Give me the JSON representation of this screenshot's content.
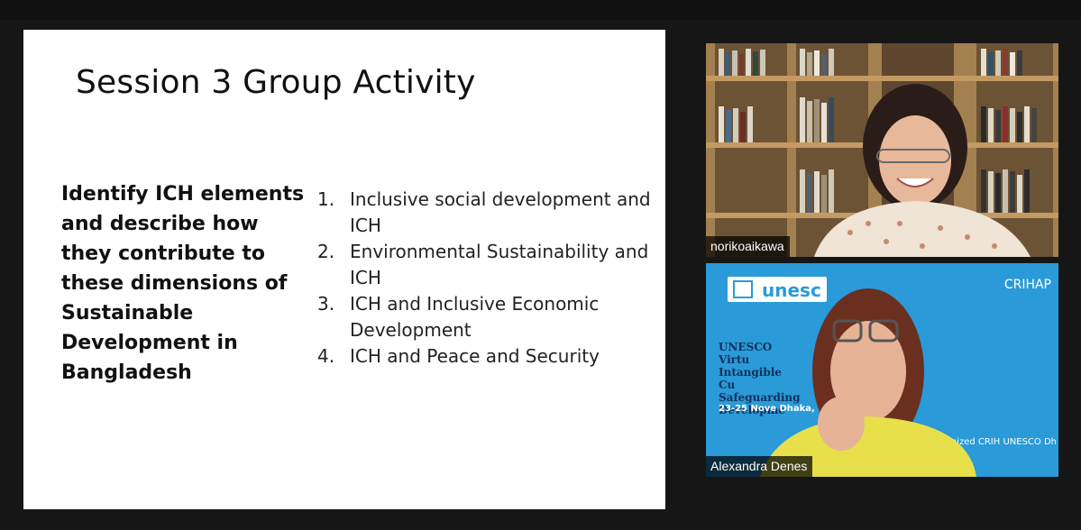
{
  "slide": {
    "title": "Session 3 Group Activity",
    "prompt": "Identify  ICH elements and describe how they contribute to these dimensions of Sustainable Development in Bangladesh",
    "items": [
      {
        "num": "1.",
        "text": "Inclusive social development and ICH"
      },
      {
        "num": "2.",
        "text": "Environmental Sustainability and ICH"
      },
      {
        "num": "3.",
        "text": "ICH and Inclusive Economic Development"
      },
      {
        "num": "4.",
        "text": "ICH and Peace and Security"
      }
    ]
  },
  "participants": [
    {
      "name": "norikoaikawa",
      "background": "bookshelf"
    },
    {
      "name": "Alexandra Denes",
      "background": "unesco-banner"
    }
  ],
  "unesco_banner": {
    "logo_text": "unesc",
    "partner_text": "CRIHAP",
    "event_lines": "UNESCO Virtu Intangible Cu Safeguarding Developme",
    "date_lines": "23-25 Nove Dhaka, Ban",
    "jointly_lines": "Jointly organized CRIH UNESCO Dh"
  },
  "colors": {
    "slide_bg": "#ffffff",
    "page_bg": "#161616",
    "unesco_blue": "#2a9ad8"
  }
}
